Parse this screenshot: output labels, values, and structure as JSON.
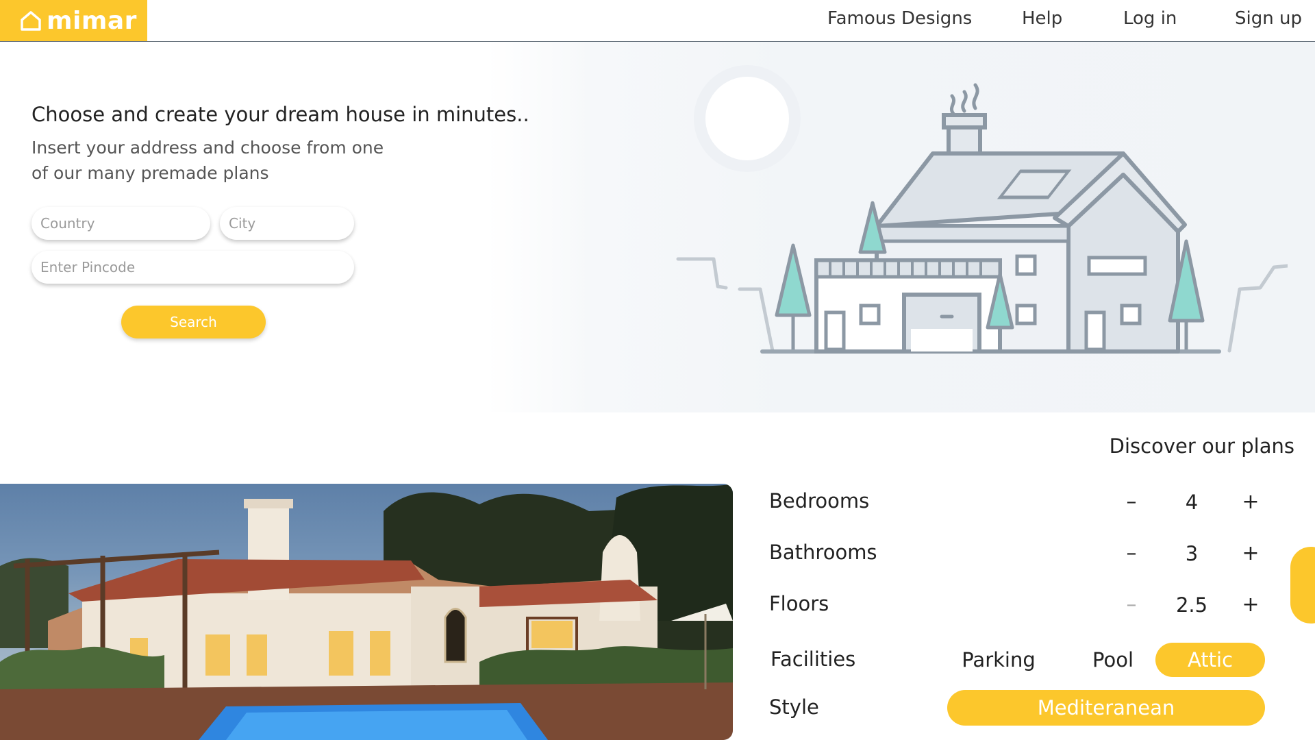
{
  "brand": {
    "name": "mimar",
    "accent": "#fcc72c"
  },
  "nav": {
    "famous_designs": "Famous Designs",
    "help": "Help",
    "login": "Log in",
    "signup": "Sign up"
  },
  "hero": {
    "headline": "Choose and create your dream house in minutes..",
    "subtext": "Insert your address and choose from one of our many premade plans",
    "country_placeholder": "Country",
    "city_placeholder": "City",
    "pincode_placeholder": "Enter Pincode",
    "search_label": "Search"
  },
  "plans": {
    "title": "Discover our plans",
    "bedrooms": {
      "label": "Bedrooms",
      "value": "4",
      "minus": "–",
      "plus": "+"
    },
    "bathrooms": {
      "label": "Bathrooms",
      "value": "3",
      "minus": "–",
      "plus": "+"
    },
    "floors": {
      "label": "Floors",
      "value": "2.5",
      "minus": "–",
      "plus": "+"
    },
    "facilities": {
      "label": "Facilities",
      "options": [
        "Parking",
        "Pool",
        "Attic"
      ],
      "selected": "Attic"
    },
    "style": {
      "label": "Style",
      "value": "Mediteranean"
    }
  }
}
